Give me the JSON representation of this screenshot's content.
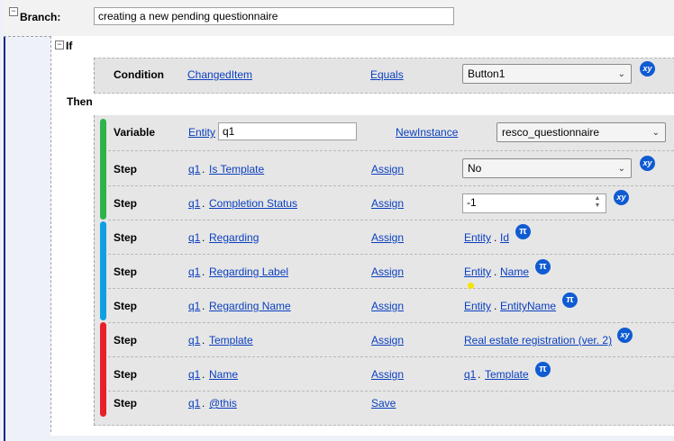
{
  "branch": {
    "label": "Branch:",
    "name_value": "creating a new pending questionnaire"
  },
  "if_block": {
    "label": "If",
    "condition": {
      "label": "Condition",
      "field": "ChangedItem",
      "operator": "Equals",
      "value": "Button1",
      "badge": "xy"
    }
  },
  "then_block": {
    "label": "Then",
    "variable": {
      "label": "Variable",
      "type_link": "Entity",
      "name_value": "q1",
      "action": "NewInstance",
      "value": "resco_questionnaire"
    },
    "steps": [
      {
        "label": "Step",
        "obj": "q1",
        "sep": ".",
        "field": "Is Template",
        "action": "Assign",
        "value_kind": "select",
        "value": "No",
        "badge": "xy"
      },
      {
        "label": "Step",
        "obj": "q1",
        "sep": ".",
        "field": "Completion Status",
        "action": "Assign",
        "value_kind": "number",
        "value": "-1",
        "badge": "xy"
      },
      {
        "label": "Step",
        "obj": "q1",
        "sep": ".",
        "field": "Regarding",
        "action": "Assign",
        "value_kind": "ref",
        "ref_obj": "Entity",
        "ref_sep": ".",
        "ref_field": "Id",
        "badge": "π"
      },
      {
        "label": "Step",
        "obj": "q1",
        "sep": ".",
        "field": "Regarding Label",
        "action": "Assign",
        "value_kind": "ref",
        "ref_obj": "Entity",
        "ref_sep": ".",
        "ref_field": "Name",
        "badge": "π"
      },
      {
        "label": "Step",
        "obj": "q1",
        "sep": ".",
        "field": "Regarding Name",
        "action": "Assign",
        "value_kind": "ref",
        "ref_obj": "Entity",
        "ref_sep": ".",
        "ref_field": "EntityName",
        "badge": "π"
      },
      {
        "label": "Step",
        "obj": "q1",
        "sep": ".",
        "field": "Template",
        "action": "Assign",
        "value_kind": "link",
        "value": "Real estate registration (ver. 2)",
        "badge": "xy"
      },
      {
        "label": "Step",
        "obj": "q1",
        "sep": ".",
        "field": "Name",
        "action": "Assign",
        "value_kind": "ref",
        "ref_obj": "q1",
        "ref_sep": ".",
        "ref_field": "Template",
        "badge": "π"
      },
      {
        "label": "Step",
        "obj": "q1",
        "sep": ".",
        "field": "@this",
        "action": "Save",
        "value_kind": "none"
      }
    ]
  },
  "colors": {
    "green": "#2db34a",
    "blue": "#0fa0e4",
    "red": "#e8202a",
    "badge": "#0f5bd2",
    "marker": "#f5e400"
  }
}
